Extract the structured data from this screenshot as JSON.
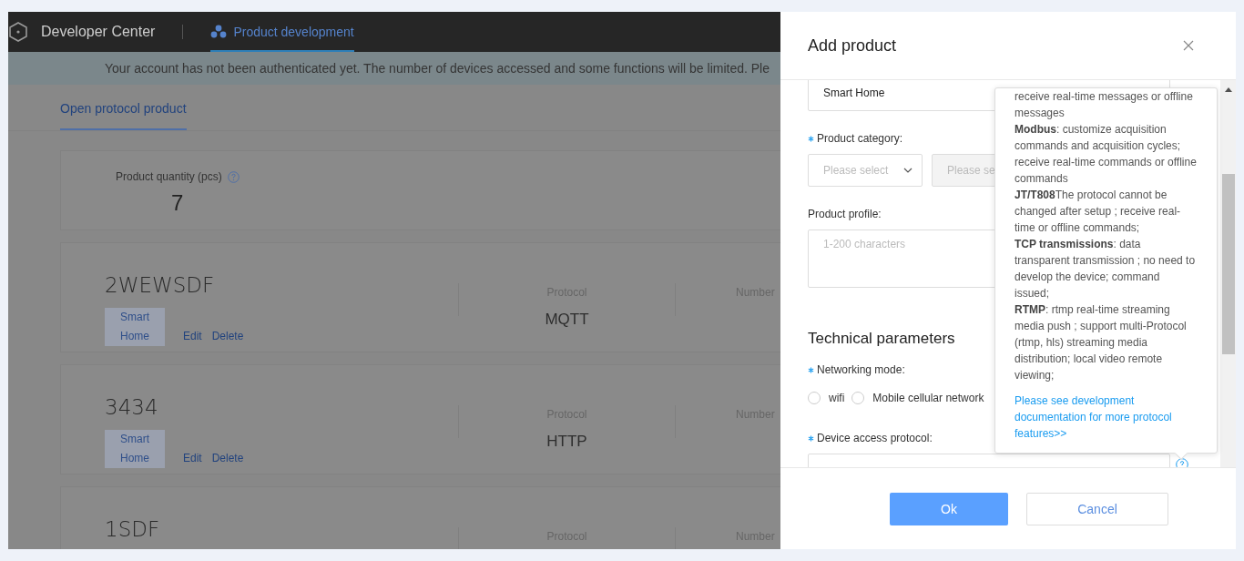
{
  "nav": {
    "title": "Developer Center",
    "tabs": [
      {
        "label": "Product development",
        "selected": true
      }
    ]
  },
  "notice": "Your account has not been authenticated yet. The number of devices accessed and some functions will be limited. Ple",
  "page_tabs": [
    {
      "label": "Open protocol product",
      "selected": true
    }
  ],
  "summary": {
    "label": "Product quantity (pcs)",
    "value": "7"
  },
  "products": [
    {
      "name": "2WEWSDF",
      "tag": "Smart Home",
      "actions": [
        "Edit",
        "Delete"
      ],
      "protocol_label": "Protocol",
      "protocol": "MQTT",
      "column_3_label": "Number"
    },
    {
      "name": "3434",
      "tag": "Smart Home",
      "actions": [
        "Edit",
        "Delete"
      ],
      "protocol_label": "Protocol",
      "protocol": "HTTP",
      "column_3_label": "Number"
    },
    {
      "name": "1SDF",
      "protocol_label": "Protocol",
      "column_3_label": "Number"
    }
  ],
  "dialog": {
    "title": "Add product",
    "fields": [
      {
        "kind": "input",
        "value": "Smart Home"
      },
      {
        "kind": "selects",
        "label": "Product category:",
        "required": true,
        "selects": [
          {
            "placeholder": "Please select",
            "disabled": false
          },
          {
            "placeholder": "Please se",
            "disabled": true
          }
        ]
      },
      {
        "kind": "textarea",
        "label": "Product profile:",
        "required": false,
        "placeholder": "1-200 characters"
      },
      {
        "kind": "heading",
        "label": "Technical parameters"
      },
      {
        "kind": "radios",
        "label": "Networking mode:",
        "required": true,
        "options": [
          {
            "label": "wifi",
            "selected": false
          },
          {
            "label": "Mobile cellular network",
            "selected": false
          }
        ]
      },
      {
        "kind": "input",
        "label": "Device access protocol:",
        "required": true,
        "help": true
      }
    ],
    "tooltip": {
      "paragraphs": [
        "receive real-time messages or offline messages",
        "**Modbus**: customize acquisition commands and acquisition cycles; receive real-time commands or offline commands",
        "**JT/T808**The protocol cannot be changed after setup ; receive real-time or offline commands;",
        "**TCP transmissions**: data transparent transmission ; no need to develop the device; command issued;",
        "**RTMP**: rtmp real-time streaming media push ; support multi-Protocol (rtmp, hls) streaming media distribution; local video remote viewing;"
      ],
      "link": "Please see development documentation for more protocol features>>"
    },
    "buttons": [
      {
        "label": "Ok",
        "kind": "primary"
      },
      {
        "label": "Cancel",
        "kind": "default"
      }
    ]
  }
}
